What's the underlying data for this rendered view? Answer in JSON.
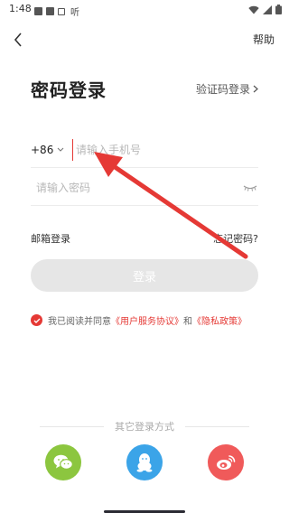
{
  "status_bar": {
    "time": "1:48",
    "listen_glyph": "听",
    "icons": [
      "image-icon",
      "square-icon",
      "a-icon",
      "wifi-icon",
      "signal-icon",
      "battery-icon"
    ]
  },
  "header": {
    "back_icon": "chevron-left-icon",
    "help_label": "帮助"
  },
  "title": "密码登录",
  "switch_login_label": "验证码登录",
  "form": {
    "country_code": "+86",
    "phone_placeholder": "请输入手机号",
    "password_placeholder": "请输入密码"
  },
  "email_login_label": "邮箱登录",
  "forgot_password_label": "忘记密码?",
  "login_button_label": "登录",
  "agreement": {
    "checked": true,
    "prefix": "我已阅读并同意",
    "user_agreement": "《用户服务协议》",
    "and": "和",
    "privacy_policy": "《隐私政策》"
  },
  "other_login": {
    "label": "其它登录方式",
    "methods": [
      {
        "name": "wechat",
        "color": "#8cc63f"
      },
      {
        "name": "qq",
        "color": "#3ba4e8"
      },
      {
        "name": "weibo",
        "color": "#f05a5a"
      }
    ]
  },
  "colors": {
    "accent": "#e53935",
    "annotation_arrow": "#e53935",
    "button_disabled": "#e6e6e6"
  }
}
